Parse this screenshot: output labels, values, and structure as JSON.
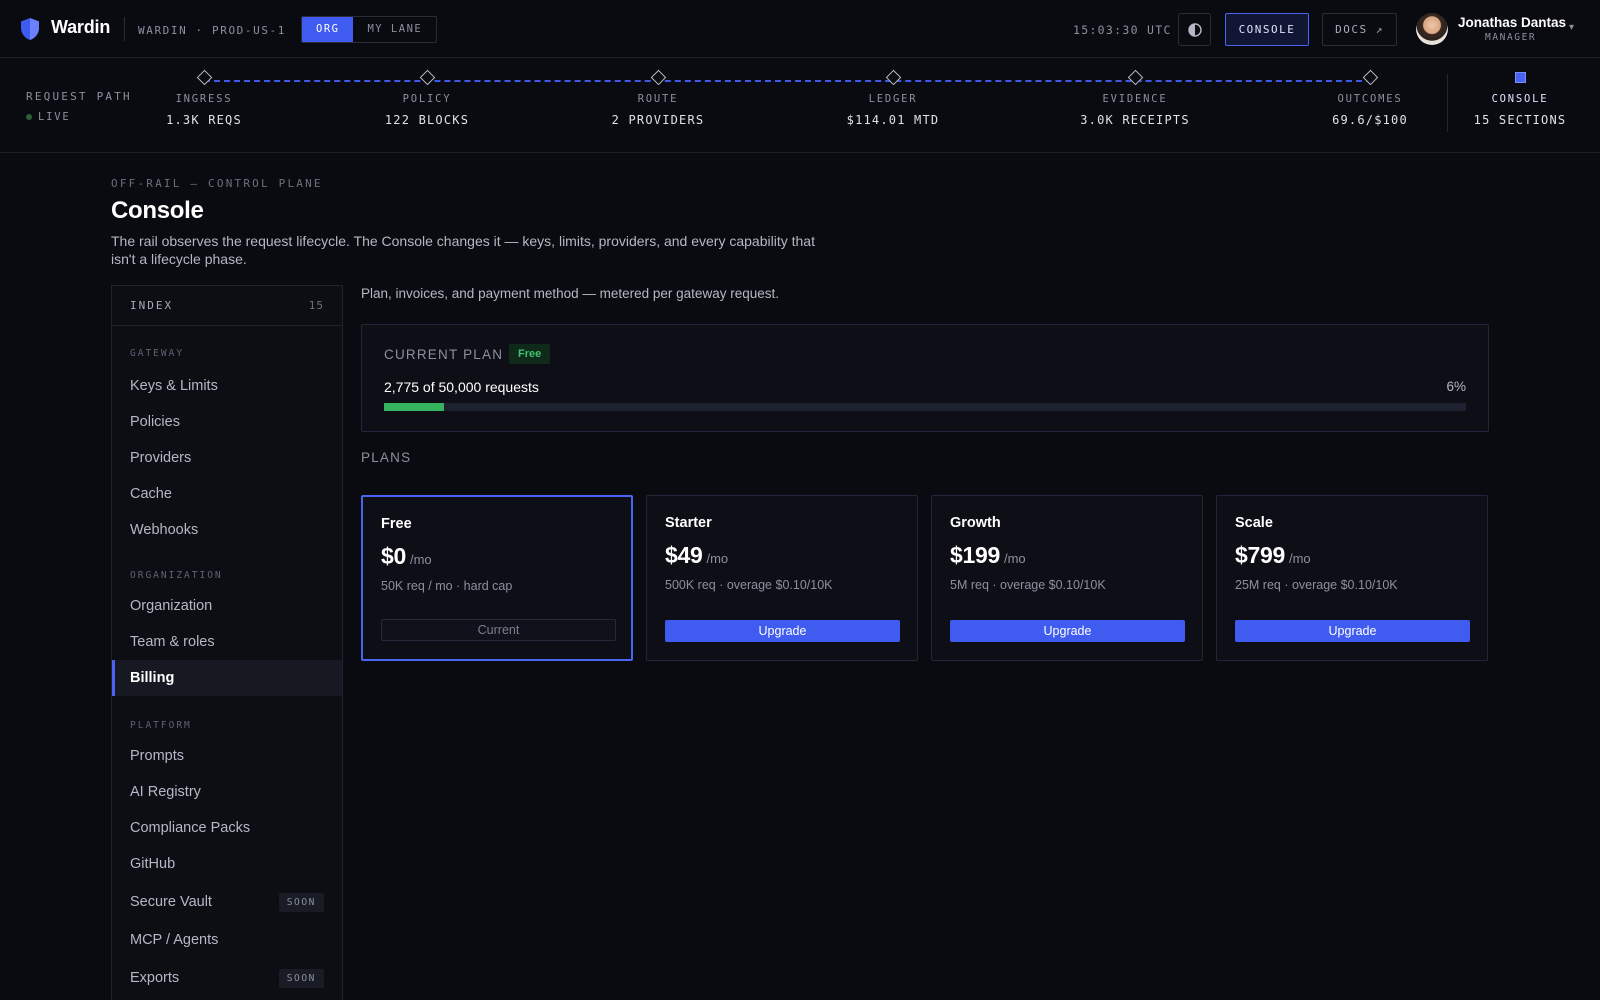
{
  "header": {
    "brand": "Wardin",
    "env": "WARDIN · PROD-US-1",
    "scope_tabs": [
      {
        "label": "ORG",
        "active": true
      },
      {
        "label": "MY LANE",
        "active": false
      }
    ],
    "clock": "15:03:30 UTC",
    "console_label": "CONSOLE",
    "docs_label": "DOCS ↗",
    "user": {
      "name": "Jonathas Dantas",
      "role": "MANAGER"
    },
    "accent": "#3f5bf0"
  },
  "rail": {
    "title": "REQUEST PATH",
    "live_label": "LIVE",
    "stages": [
      {
        "label": "INGRESS",
        "value": "1.3K REQS"
      },
      {
        "label": "POLICY",
        "value": "122 BLOCKS"
      },
      {
        "label": "ROUTE",
        "value": "2 PROVIDERS"
      },
      {
        "label": "LEDGER",
        "value": "$114.01 MTD"
      },
      {
        "label": "EVIDENCE",
        "value": "3.0K RECEIPTS"
      },
      {
        "label": "OUTCOMES",
        "value": "69.6/$100"
      },
      {
        "label": "CONSOLE",
        "value": "15 SECTIONS",
        "active": true
      }
    ]
  },
  "page": {
    "eyebrow": "OFF-RAIL — CONTROL PLANE",
    "title": "Console",
    "description": "The rail observes the request lifecycle. The Console changes it — keys, limits, providers, and every capability that isn't a lifecycle phase."
  },
  "sidebar": {
    "index_label": "INDEX",
    "index_count": "15",
    "groups": [
      {
        "label": "GATEWAY",
        "items": [
          {
            "label": "Keys & Limits"
          },
          {
            "label": "Policies"
          },
          {
            "label": "Providers"
          },
          {
            "label": "Cache"
          },
          {
            "label": "Webhooks"
          }
        ]
      },
      {
        "label": "ORGANIZATION",
        "items": [
          {
            "label": "Organization"
          },
          {
            "label": "Team & roles"
          },
          {
            "label": "Billing",
            "active": true
          }
        ]
      },
      {
        "label": "PLATFORM",
        "items": [
          {
            "label": "Prompts"
          },
          {
            "label": "AI Registry"
          },
          {
            "label": "Compliance Packs"
          },
          {
            "label": "GitHub"
          },
          {
            "label": "Secure Vault",
            "badge": "SOON"
          },
          {
            "label": "MCP / Agents"
          },
          {
            "label": "Exports",
            "badge": "SOON"
          }
        ]
      }
    ]
  },
  "billing": {
    "description": "Plan, invoices, and payment method — metered per gateway request.",
    "current_plan": {
      "label": "CURRENT PLAN",
      "badge": "Free",
      "usage_text": "2,775 of 50,000 requests",
      "percent_text": "6%",
      "progress": 0.0555,
      "progress_color": "#36b35f"
    },
    "plans_label": "PLANS",
    "plans": [
      {
        "name": "Free",
        "price": "$0",
        "per": "/mo",
        "desc": "50K req / mo · hard cap",
        "button": "Current",
        "current": true
      },
      {
        "name": "Starter",
        "price": "$49",
        "per": "/mo",
        "desc": "500K req · overage $0.10/10K",
        "button": "Upgrade"
      },
      {
        "name": "Growth",
        "price": "$199",
        "per": "/mo",
        "desc": "5M req · overage $0.10/10K",
        "button": "Upgrade"
      },
      {
        "name": "Scale",
        "price": "$799",
        "per": "/mo",
        "desc": "25M req · overage $0.10/10K",
        "button": "Upgrade"
      }
    ]
  }
}
